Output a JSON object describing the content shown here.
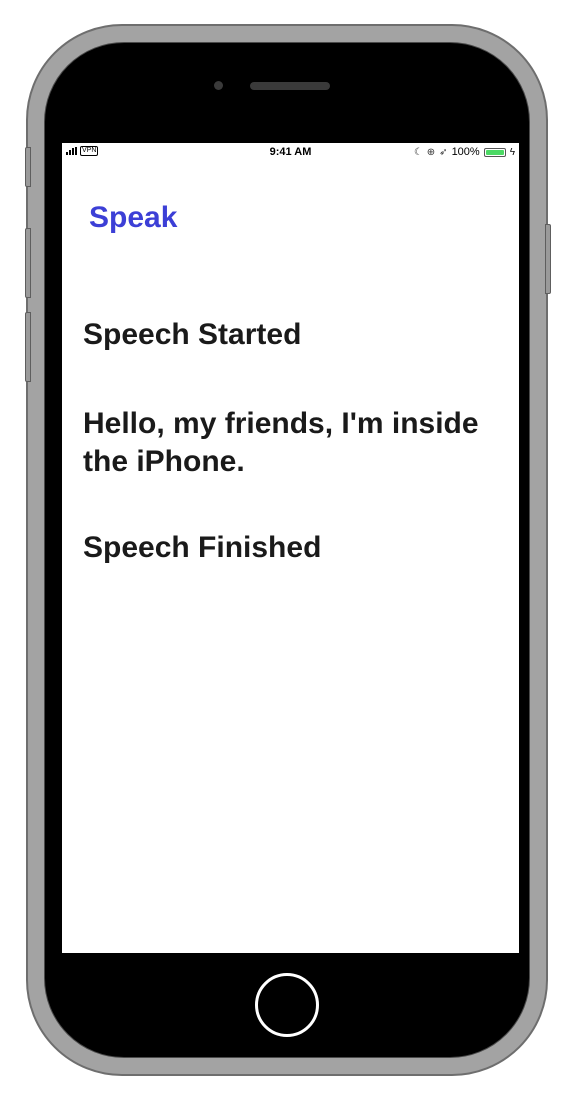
{
  "status_bar": {
    "vpn": "VPN",
    "time": "9:41 AM",
    "battery": "100%",
    "icons": [
      "signal-icon",
      "moon-icon",
      "lock-rotation-icon",
      "location-icon",
      "battery-icon",
      "charging-bolt-icon"
    ]
  },
  "main": {
    "speak_button": "Speak",
    "messages": [
      "Speech Started",
      "Hello, my friends, I'm inside the iPhone.",
      "Speech Finished"
    ]
  },
  "colors": {
    "accent": "#3c3fd6",
    "battery": "#4cd964"
  }
}
